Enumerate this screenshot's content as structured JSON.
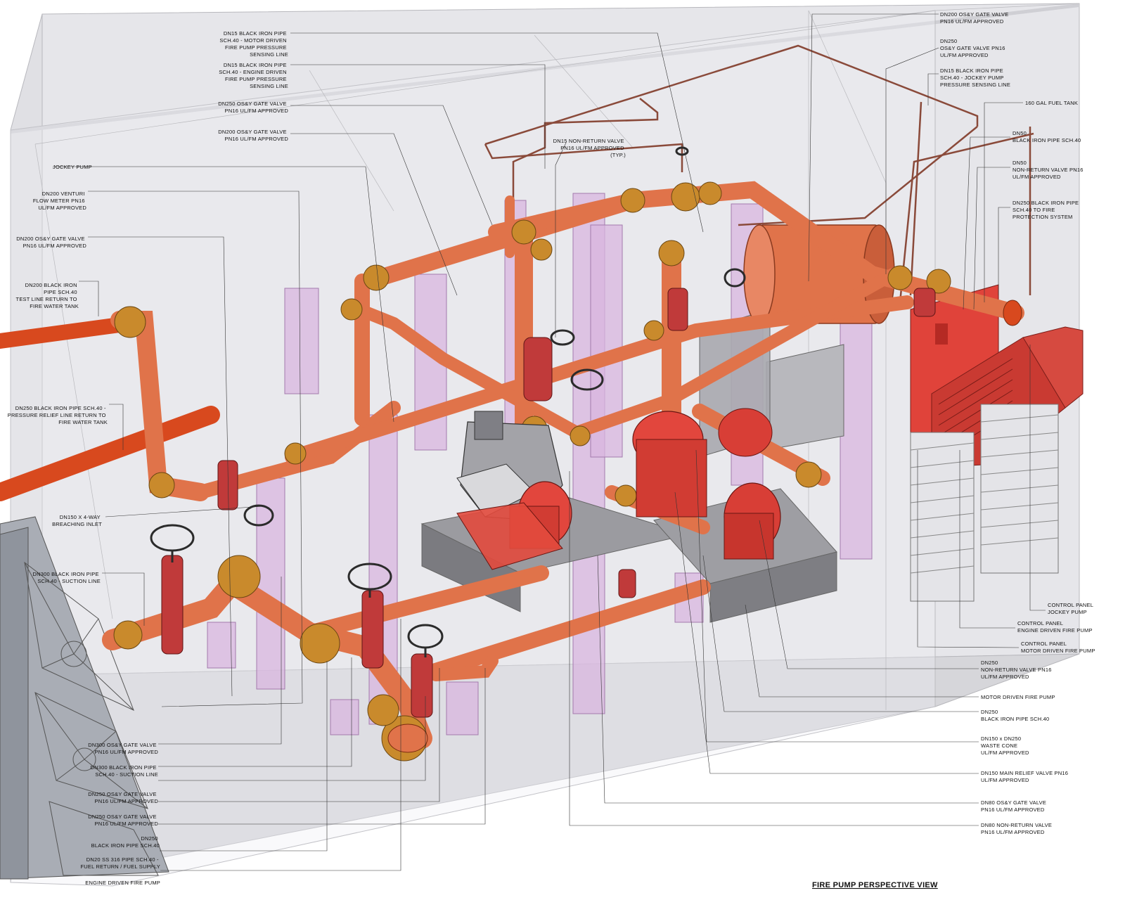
{
  "title": "FIRE PUMP PERSPECTIVE VIEW",
  "colors": {
    "pipe": "#e0734a",
    "pipe_dark": "#b74a2a",
    "fitting": "#c98a2c",
    "pump": "#d73a38",
    "support": "#d8b6df",
    "room": "#dcdce0",
    "tank": "#a8acb4"
  },
  "labels": [
    {
      "id": "l01",
      "lines": [
        "DN15 BLACK IRON PIPE",
        "SCH.40 - MOTOR DRIVEN",
        "FIRE PUMP PRESSURE",
        "SENSING LINE"
      ]
    },
    {
      "id": "l02",
      "lines": [
        "DN15 BLACK IRON PIPE",
        "SCH.40 - ENGINE DRIVEN",
        "FIRE PUMP PRESSURE",
        "SENSING LINE"
      ]
    },
    {
      "id": "l03",
      "lines": [
        "DN250 OS&Y GATE VALVE",
        "PN16 UL/FM APPROVED"
      ]
    },
    {
      "id": "l04",
      "lines": [
        "DN200 OS&Y GATE VALVE",
        "PN16 UL/FM APPROVED"
      ]
    },
    {
      "id": "l05",
      "lines": [
        "DN15 NON-RETURN VALVE",
        "PN16 UL/FM APPROVED",
        "(TYP.)"
      ]
    },
    {
      "id": "l06",
      "lines": [
        "JOCKEY PUMP"
      ]
    },
    {
      "id": "l07",
      "lines": [
        "DN200 VENTURI",
        "FLOW METER PN16",
        "UL/FM APPROVED"
      ]
    },
    {
      "id": "l08",
      "lines": [
        "DN200 OS&Y GATE VALVE",
        "PN16 UL/FM APPROVED"
      ]
    },
    {
      "id": "l09",
      "lines": [
        "DN200 BLACK IRON",
        "PIPE SCH.40",
        "TEST LINE RETURN TO",
        "FIRE WATER TANK"
      ]
    },
    {
      "id": "l10",
      "lines": [
        "DN250 BLACK IRON PIPE SCH.40 -",
        "PRESSURE RELIEF LINE RETURN TO",
        "FIRE WATER TANK"
      ]
    },
    {
      "id": "l11",
      "lines": [
        "DN150 X 4-WAY",
        "BREACHING INLET"
      ]
    },
    {
      "id": "l12",
      "lines": [
        "DN300 BLACK IRON PIPE",
        "SCH.40 - SUCTION LINE"
      ]
    },
    {
      "id": "l13",
      "lines": [
        "DN300 OS&Y GATE VALVE",
        "PN16 UL/FM APPROVED"
      ]
    },
    {
      "id": "l14",
      "lines": [
        "DN300 BLACK IRON PIPE",
        "SCH.40 - SUCTION LINE"
      ]
    },
    {
      "id": "l15",
      "lines": [
        "DN250 OS&Y GATE VALVE",
        "PN16 UL/FM APPROVED"
      ]
    },
    {
      "id": "l16",
      "lines": [
        "DN250 OS&Y GATE VALVE",
        "PN16 UL/FM APPROVED"
      ]
    },
    {
      "id": "l17",
      "lines": [
        "DN250",
        "BLACK IRON PIPE SCH.40"
      ]
    },
    {
      "id": "l18",
      "lines": [
        "DN20 SS 316 PIPE SCH.40 -",
        "FUEL RETURN / FUEL SUPPLY"
      ]
    },
    {
      "id": "l19",
      "lines": [
        "ENGINE DRIVEN FIRE PUMP"
      ]
    },
    {
      "id": "r01",
      "lines": [
        "DN200 OS&Y GATE VALVE",
        "PN16 UL/FM APPROVED"
      ]
    },
    {
      "id": "r02",
      "lines": [
        "DN250",
        "OS&Y GATE VALVE PN16",
        "UL/FM APPROVED"
      ]
    },
    {
      "id": "r03",
      "lines": [
        "DN15 BLACK IRON PIPE",
        "SCH.40 - JOCKEY PUMP",
        "PRESSURE SENSING LINE"
      ]
    },
    {
      "id": "r04",
      "lines": [
        "160 GAL FUEL TANK"
      ]
    },
    {
      "id": "r05",
      "lines": [
        "DN50",
        "BLACK IRON PIPE SCH.40"
      ]
    },
    {
      "id": "r06",
      "lines": [
        "DN50",
        "NON-RETURN VALVE PN16",
        "UL/FM APPROVED"
      ]
    },
    {
      "id": "r07",
      "lines": [
        "DN250 BLACK IRON PIPE",
        "SCH.40 TO FIRE",
        "PROTECTION SYSTEM"
      ]
    },
    {
      "id": "r08",
      "lines": [
        "CONTROL PANEL",
        "JOCKEY PUMP"
      ]
    },
    {
      "id": "r09",
      "lines": [
        "CONTROL PANEL",
        "ENGINE DRIVEN FIRE PUMP"
      ]
    },
    {
      "id": "r10",
      "lines": [
        "CONTROL PANEL",
        "MOTOR DRIVEN FIRE PUMP"
      ]
    },
    {
      "id": "r11",
      "lines": [
        "DN250",
        "NON-RETURN VALVE PN16",
        "UL/FM APPROVED"
      ]
    },
    {
      "id": "r12",
      "lines": [
        "MOTOR DRIVEN FIRE PUMP"
      ]
    },
    {
      "id": "r13",
      "lines": [
        "DN250",
        "BLACK IRON PIPE SCH.40"
      ]
    },
    {
      "id": "r14",
      "lines": [
        "DN150 x DN250",
        "WASTE CONE",
        "UL/FM APPROVED"
      ]
    },
    {
      "id": "r15",
      "lines": [
        "DN150 MAIN RELIEF VALVE PN16",
        "UL/FM APPROVED"
      ]
    },
    {
      "id": "r16",
      "lines": [
        "DN80 OS&Y GATE VALVE",
        "PN16 UL/FM APPROVED"
      ]
    },
    {
      "id": "r17",
      "lines": [
        "DN80 NON-RETURN VALVE",
        "PN16 UL/FM APPROVED"
      ]
    }
  ]
}
